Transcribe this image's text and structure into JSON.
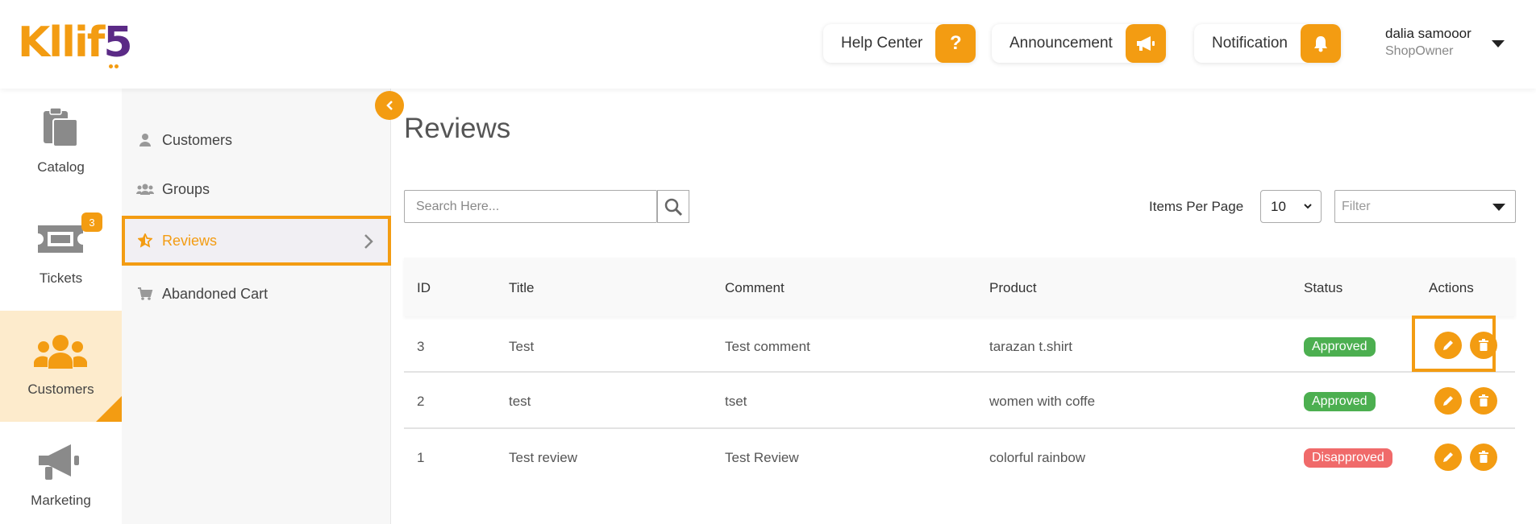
{
  "header": {
    "logo_main": "Kllif",
    "logo_accent": "5",
    "help_center": "Help Center",
    "announcement": "Announcement",
    "notification": "Notification",
    "user_name": "dalia samooor",
    "user_role": "ShopOwner"
  },
  "rail": {
    "items": [
      {
        "label": "Catalog",
        "icon": "clipboard-icon"
      },
      {
        "label": "Tickets",
        "icon": "ticket-icon",
        "badge": "3"
      },
      {
        "label": "Customers",
        "icon": "users-icon",
        "active": true
      },
      {
        "label": "Marketing",
        "icon": "megaphone-icon"
      }
    ]
  },
  "submenu": {
    "items": [
      {
        "label": "Customers",
        "icon": "user-icon"
      },
      {
        "label": "Groups",
        "icon": "group-icon"
      },
      {
        "label": "Reviews",
        "icon": "star-icon",
        "active": true
      },
      {
        "label": "Abandoned Cart",
        "icon": "cart-icon"
      }
    ]
  },
  "main": {
    "title": "Reviews",
    "search_placeholder": "Search Here...",
    "items_per_page_label": "Items Per Page",
    "items_per_page_value": "10",
    "filter_placeholder": "Filter"
  },
  "table": {
    "headers": [
      "ID",
      "Title",
      "Comment",
      "Product",
      "Status",
      "Actions"
    ],
    "rows": [
      {
        "id": "3",
        "title": "Test",
        "comment": "Test comment",
        "product": "tarazan t.shirt",
        "status": "Approved"
      },
      {
        "id": "2",
        "title": "test",
        "comment": "tset",
        "product": "women with coffe",
        "status": "Approved"
      },
      {
        "id": "1",
        "title": "Test review",
        "comment": "Test Review",
        "product": "colorful rainbow",
        "status": "Disapproved"
      }
    ]
  },
  "colors": {
    "accent": "#f39c12",
    "brand_purple": "#5b2a86",
    "approved": "#4caf50",
    "disapproved": "#f06a6a"
  }
}
